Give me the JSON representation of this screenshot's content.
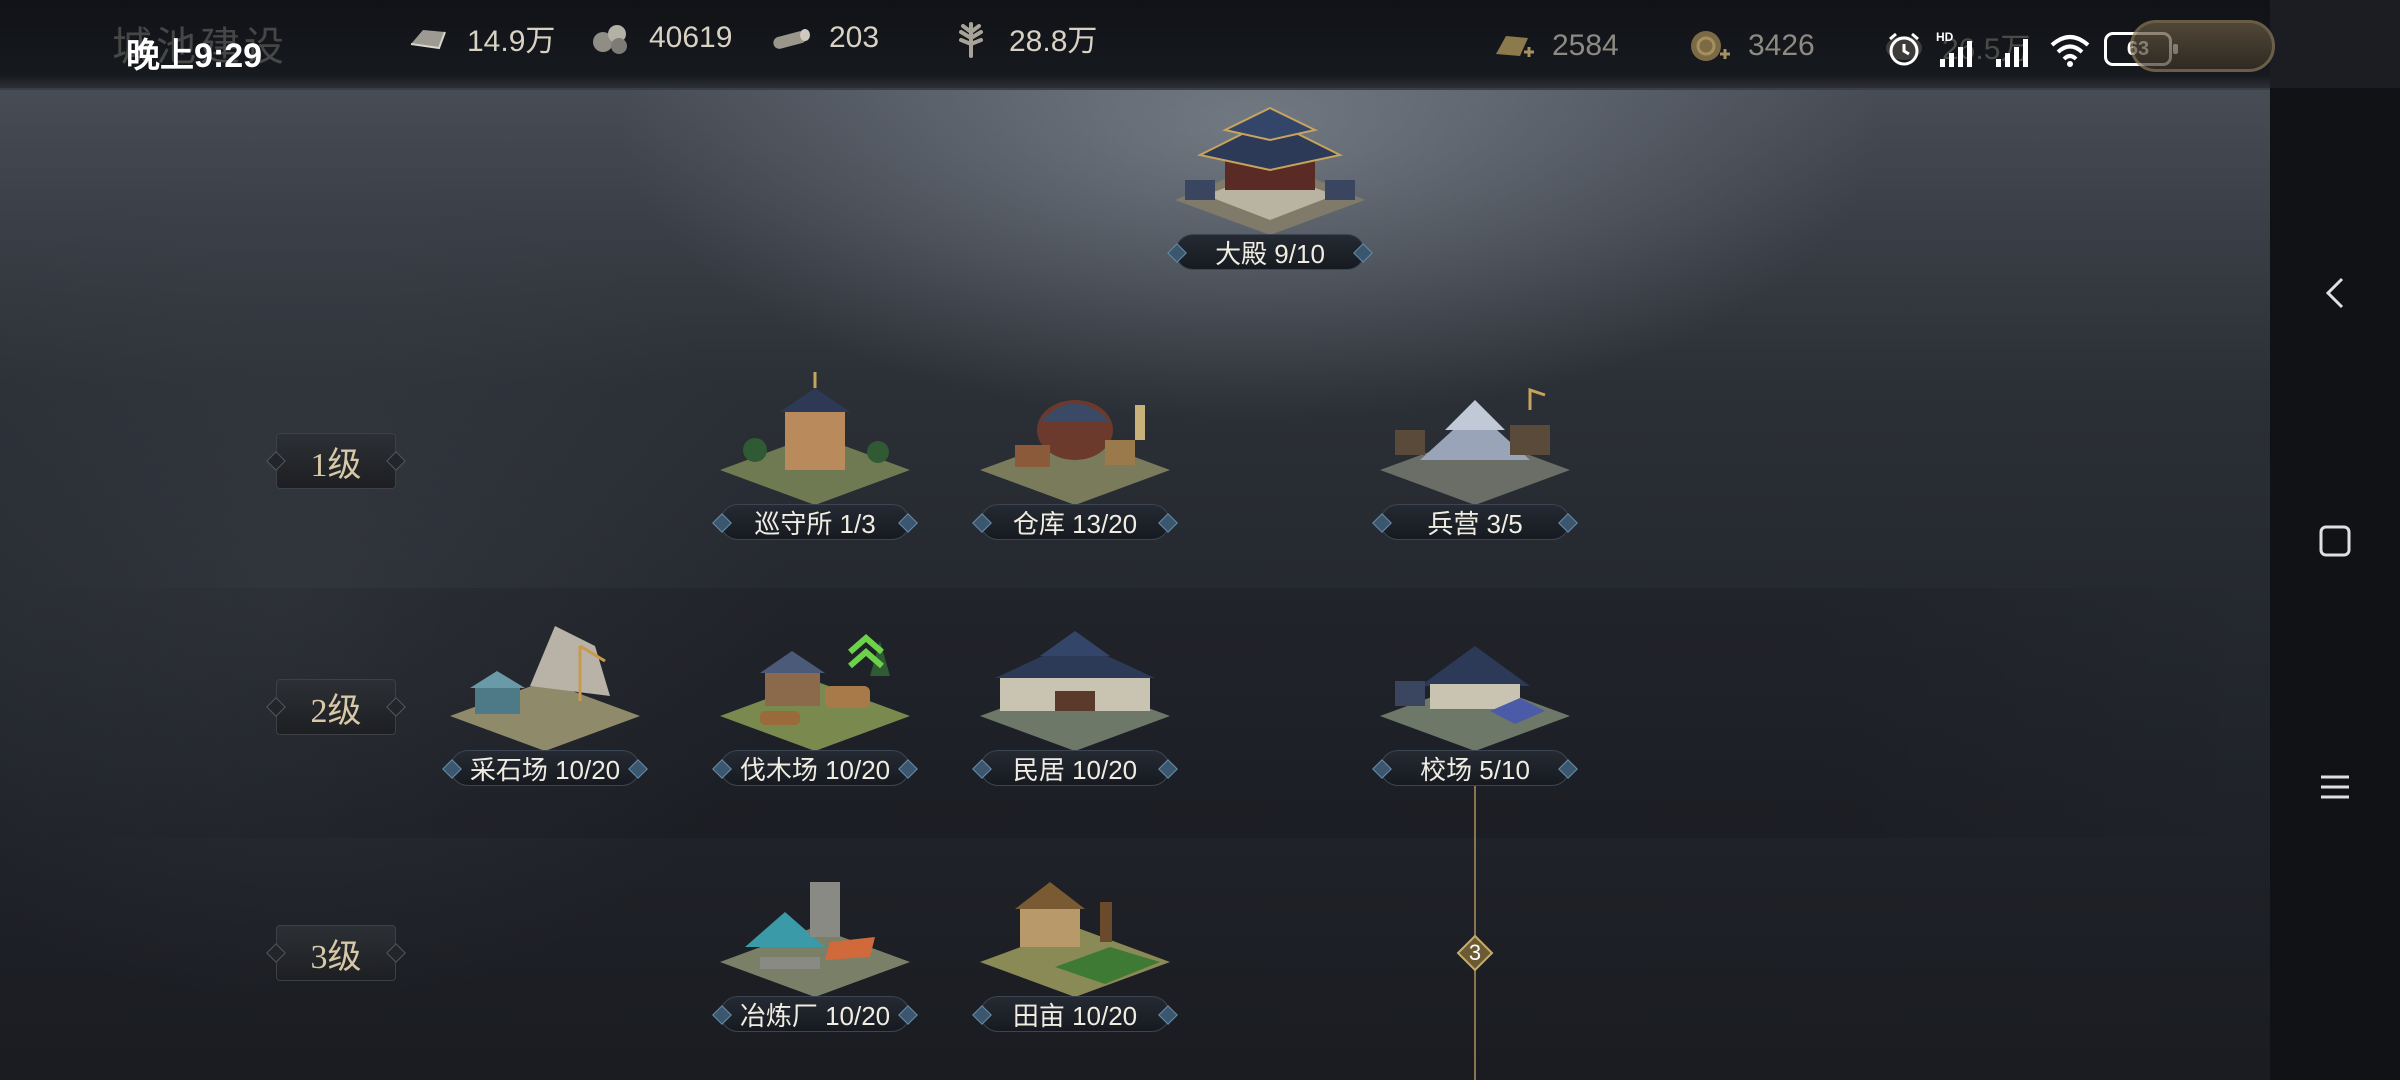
{
  "top_bar": {
    "page_title": "城池建设",
    "clock": "晚上9:29",
    "resources": [
      {
        "icon": "iron-ingot-icon",
        "value": "14.9万"
      },
      {
        "icon": "stone-icon",
        "value": "40619"
      },
      {
        "icon": "wood-log-icon",
        "value": "203"
      },
      {
        "icon": "grain-icon",
        "value": "28.8万"
      }
    ],
    "currencies": [
      {
        "icon": "gold-bar-add-icon",
        "value": "2584"
      },
      {
        "icon": "coin-add-icon",
        "value": "3426"
      },
      {
        "icon": "silver-icon",
        "value": "26.5万"
      }
    ],
    "battery": "63"
  },
  "tiers": [
    {
      "label": "1级"
    },
    {
      "label": "2级"
    },
    {
      "label": "3级"
    }
  ],
  "buildings": {
    "palace": {
      "label": "大殿 9/10"
    },
    "patrol": {
      "label": "巡守所 1/3"
    },
    "warehouse": {
      "label": "仓库 13/20"
    },
    "barracks": {
      "label": "兵营 3/5"
    },
    "quarry": {
      "label": "采石场 10/20"
    },
    "lumber": {
      "label": "伐木场 10/20"
    },
    "residence": {
      "label": "民居 10/20"
    },
    "training": {
      "label": "校场 5/10"
    },
    "smelter": {
      "label": "冶炼厂 10/20"
    },
    "farm": {
      "label": "田亩 10/20"
    }
  },
  "tree_node": {
    "value": "3"
  },
  "colors": {
    "accent_gold": "#8a7450",
    "plate_border": "#3c4552",
    "upgrade_green": "#6cd24a"
  }
}
